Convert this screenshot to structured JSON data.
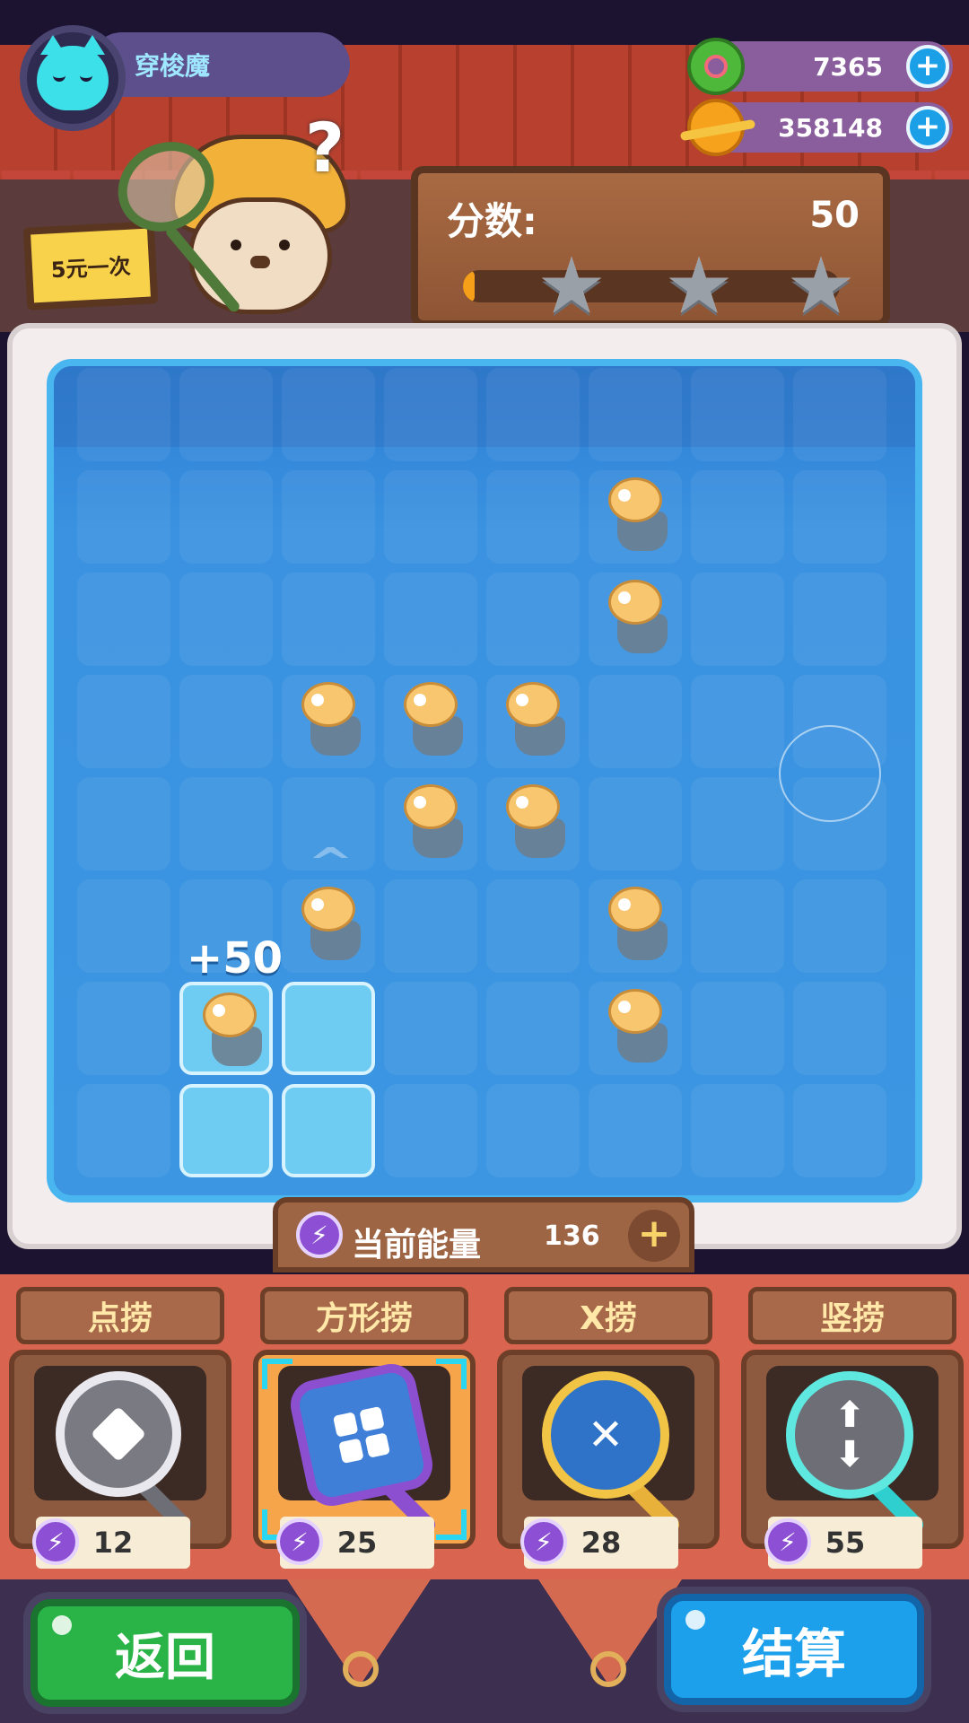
{
  "player": {
    "name": "穿梭魔"
  },
  "resources": [
    {
      "icon": "donut-icon",
      "value": "7365"
    },
    {
      "icon": "planet-coin-icon",
      "value": "358148"
    }
  ],
  "shop_sign": "5元一次",
  "score": {
    "label": "分数:",
    "value": "50",
    "progress": 0.03,
    "stars_total": 3,
    "stars_earned": 0
  },
  "floating_score": "+50",
  "board": {
    "rows": 8,
    "cols": 8,
    "fish": [
      [
        1,
        5
      ],
      [
        2,
        5
      ],
      [
        3,
        2
      ],
      [
        3,
        3
      ],
      [
        3,
        4
      ],
      [
        4,
        3
      ],
      [
        4,
        4
      ],
      [
        5,
        2
      ],
      [
        5,
        5
      ],
      [
        6,
        1
      ],
      [
        6,
        5
      ]
    ],
    "highlighted": [
      [
        6,
        1
      ],
      [
        6,
        2
      ],
      [
        7,
        1
      ],
      [
        7,
        2
      ]
    ]
  },
  "energy": {
    "label": "当前能量",
    "value": "136",
    "add": "+"
  },
  "tools": [
    {
      "name": "点捞",
      "cost": "12",
      "icon": "diamond-net-icon",
      "selected": false
    },
    {
      "name": "方形捞",
      "cost": "25",
      "icon": "square-net-icon",
      "selected": true
    },
    {
      "name": "X捞",
      "cost": "28",
      "icon": "x-net-icon",
      "selected": false
    },
    {
      "name": "竖捞",
      "cost": "55",
      "icon": "vertical-net-icon",
      "selected": false
    }
  ],
  "buttons": {
    "back": "返回",
    "settle": "结算"
  },
  "colors": {
    "energy_bolt": "#8d4fd4",
    "back_button": "#2ab447",
    "settle_button": "#1ca0ec",
    "pool": "#3c96e2"
  }
}
